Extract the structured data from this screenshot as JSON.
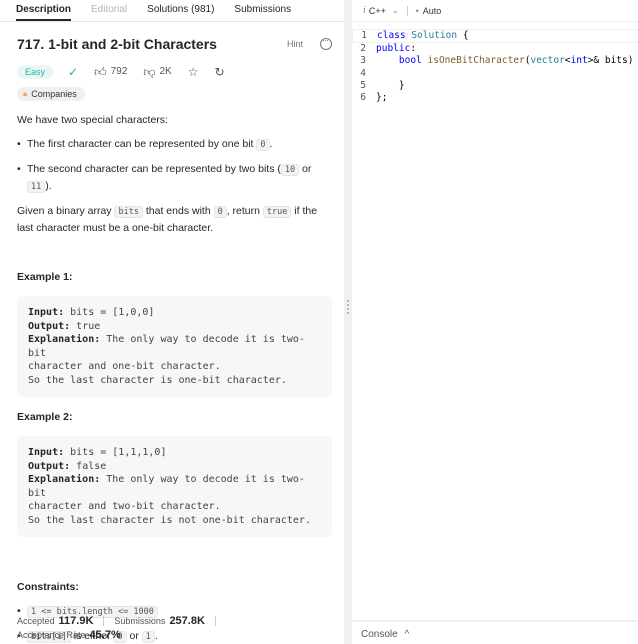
{
  "tabs": [
    {
      "label": "Description",
      "active": true
    },
    {
      "label": "Editorial",
      "dim": true
    },
    {
      "label": "Solutions (981)"
    },
    {
      "label": "Submissions"
    }
  ],
  "problem": {
    "title": "717. 1-bit and 2-bit Characters",
    "hint": "Hint",
    "difficulty": "Easy",
    "likes": "792",
    "dislikes": "2K",
    "companies": "Companies",
    "intro": "We have two special characters:",
    "bullet1_pre": "The first character can be represented by one bit ",
    "bullet1_code": "0",
    "bullet1_post": ".",
    "bullet2_pre": "The second character can be represented by two bits (",
    "bullet2_code1": "10",
    "bullet2_mid": " or ",
    "bullet2_code2": "11",
    "bullet2_post": ").",
    "given_1": "Given a binary array ",
    "given_code1": "bits",
    "given_2": " that ends with ",
    "given_code2": "0",
    "given_3": ", return ",
    "given_code3": "true",
    "given_4": " if the last character must be a one-bit character."
  },
  "examples": [
    {
      "heading": "Example 1:",
      "input_label": "Input:",
      "input": " bits = [1,0,0]",
      "output_label": "Output:",
      "output": " true",
      "explanation_label": "Explanation:",
      "explanation_1": " The only way to decode it is two-bit",
      "explanation_2": "character and one-bit character.",
      "explanation_3": "So the last character is one-bit character."
    },
    {
      "heading": "Example 2:",
      "input_label": "Input:",
      "input": " bits = [1,1,1,0]",
      "output_label": "Output:",
      "output": " false",
      "explanation_label": "Explanation:",
      "explanation_1": " The only way to decode it is two-bit",
      "explanation_2": "character and two-bit character.",
      "explanation_3": "So the last character is not one-bit character."
    }
  ],
  "constraints": {
    "heading": "Constraints:",
    "c1_code": "1 <= bits.length <= 1000",
    "c2_code1": "bits[i]",
    "c2_mid": " is either ",
    "c2_code2": "0",
    "c2_or": " or ",
    "c2_code3": "1",
    "c2_post": "."
  },
  "stats": {
    "accepted_label": "Accepted",
    "accepted_value": "117.9K",
    "submissions_label": "Submissions",
    "submissions_value": "257.8K",
    "rate_label": "Acceptance Rate",
    "rate_value": "45.7%"
  },
  "editor": {
    "lang_icon": "i",
    "language": "C++",
    "mode": "Auto",
    "lines": [
      {
        "n": "1",
        "parts": [
          [
            "kw",
            "class "
          ],
          [
            "ty",
            "Solution"
          ],
          [
            "tx",
            " {"
          ]
        ]
      },
      {
        "n": "2",
        "parts": [
          [
            "kw",
            "public"
          ],
          [
            "tx",
            ":"
          ]
        ]
      },
      {
        "n": "3",
        "parts": [
          [
            "tx",
            "    "
          ],
          [
            "kw",
            "bool "
          ],
          [
            "fn",
            "isOneBitCharacter"
          ],
          [
            "tx",
            "("
          ],
          [
            "ty",
            "vector"
          ],
          [
            "tx",
            "<"
          ],
          [
            "kw",
            "int"
          ],
          [
            "tx",
            ">& bits) {"
          ]
        ]
      },
      {
        "n": "4",
        "parts": [
          [
            "tx",
            ""
          ]
        ]
      },
      {
        "n": "5",
        "parts": [
          [
            "tx",
            "    }"
          ]
        ]
      },
      {
        "n": "6",
        "parts": [
          [
            "tx",
            "};"
          ]
        ]
      }
    ]
  },
  "console": {
    "label": "Console",
    "chevron": "^"
  },
  "colors": {
    "easy": "#1cb8a8",
    "accent_check": "#2cbb5d",
    "keyword": "#0000ff",
    "type": "#267f99",
    "function": "#795e26"
  }
}
